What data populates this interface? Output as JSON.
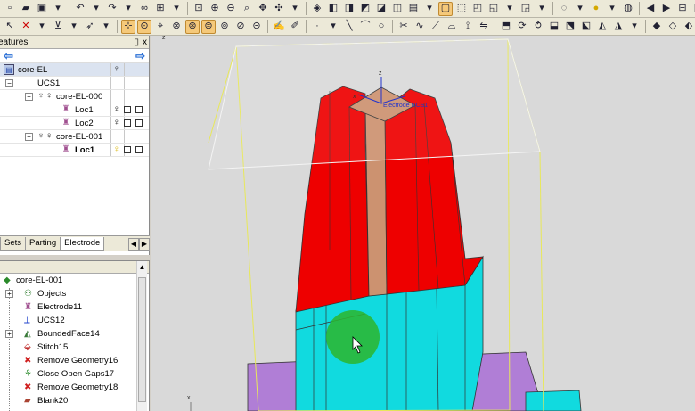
{
  "features_panel": {
    "title": "eatures",
    "pin_icon": "pin-icon",
    "close_label": "x",
    "tree": [
      {
        "label": "core-EL",
        "level": 0
      },
      {
        "label": "UCS1",
        "level": 1
      },
      {
        "label": "core-EL-000",
        "level": 2
      },
      {
        "label": "Loc1",
        "level": 3
      },
      {
        "label": "Loc2",
        "level": 3
      },
      {
        "label": "core-EL-001",
        "level": 2
      },
      {
        "label": "Loc1",
        "level": 3
      }
    ]
  },
  "tabs": [
    "Sets",
    "Parting",
    "Electrode"
  ],
  "operations_panel": {
    "root_label": "core-EL-001",
    "items": [
      {
        "label": "Objects",
        "expandable": true
      },
      {
        "label": "Electrode11",
        "expandable": false
      },
      {
        "label": "UCS12",
        "expandable": false
      },
      {
        "label": "BoundedFace14",
        "expandable": true
      },
      {
        "label": "Stitch15",
        "expandable": false
      },
      {
        "label": "Remove Geometry16",
        "expandable": false
      },
      {
        "label": "Close Open Gaps17",
        "expandable": false
      },
      {
        "label": "Remove Geometry18",
        "expandable": false
      },
      {
        "label": "Blank20",
        "expandable": false
      }
    ]
  },
  "viewport": {
    "ucs_label": "Electrode UCS1",
    "axis_z": "z",
    "axis_x": "x",
    "corner_z": "z",
    "colors": {
      "red": "#ee0000",
      "copper": "#cc9270",
      "cyan": "#11dadf",
      "purple": "#b07ed6",
      "green_marker": "#2db52d"
    }
  }
}
